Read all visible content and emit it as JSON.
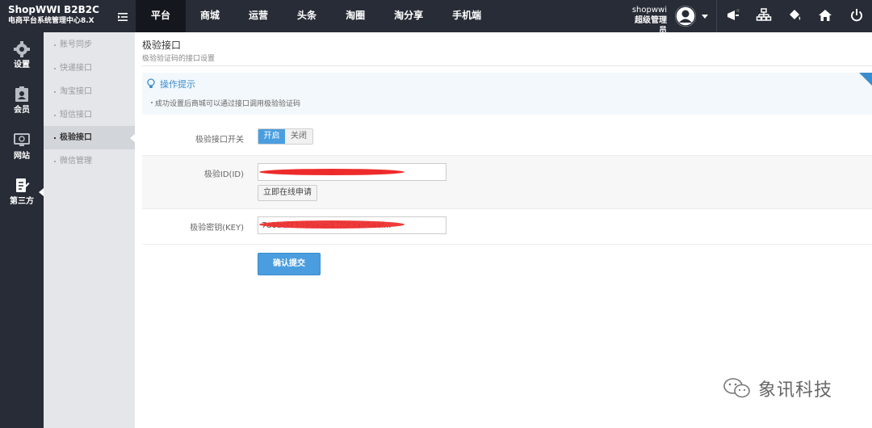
{
  "brand": {
    "title": "ShopWWI B2B2C",
    "subtitle": "电商平台系统管理中心8.X"
  },
  "nav": {
    "items": [
      "平台",
      "商城",
      "运营",
      "头条",
      "淘圈",
      "淘分享",
      "手机端"
    ]
  },
  "user": {
    "name": "shopwwi",
    "role": "超级管理员"
  },
  "sidebar": {
    "items": [
      {
        "label": "设置",
        "icon": "gear-icon"
      },
      {
        "label": "会员",
        "icon": "member-card-icon"
      },
      {
        "label": "网站",
        "icon": "website-icon"
      },
      {
        "label": "第三方",
        "icon": "third-party-icon"
      }
    ]
  },
  "submenu": {
    "items": [
      "账号同步",
      "快递接口",
      "淘宝接口",
      "短信接口",
      "极验接口",
      "微信管理"
    ],
    "active_index": 4
  },
  "page": {
    "title": "极验接口",
    "subtitle": "极验验证码的接口设置"
  },
  "tips": {
    "title": "操作提示",
    "text": "成功设置后商城可以通过接口调用极验验证码"
  },
  "form": {
    "switch_label": "极验接口开关",
    "switch_on": "开启",
    "switch_off": "关闭",
    "id_label": "极验ID(ID)",
    "apply_button": "立即在线申请",
    "key_label": "极验密钥(KEY)",
    "key_value_visible": "7a8bcf71099aae87f0f3a95a4f...",
    "submit": "确认提交"
  },
  "watermark": {
    "text": "象讯科技"
  },
  "colors": {
    "topbar": "#272c36",
    "accent": "#4a9ee0",
    "submenu_bg": "#e4e6ea",
    "redaction": "#ee2b2b"
  }
}
